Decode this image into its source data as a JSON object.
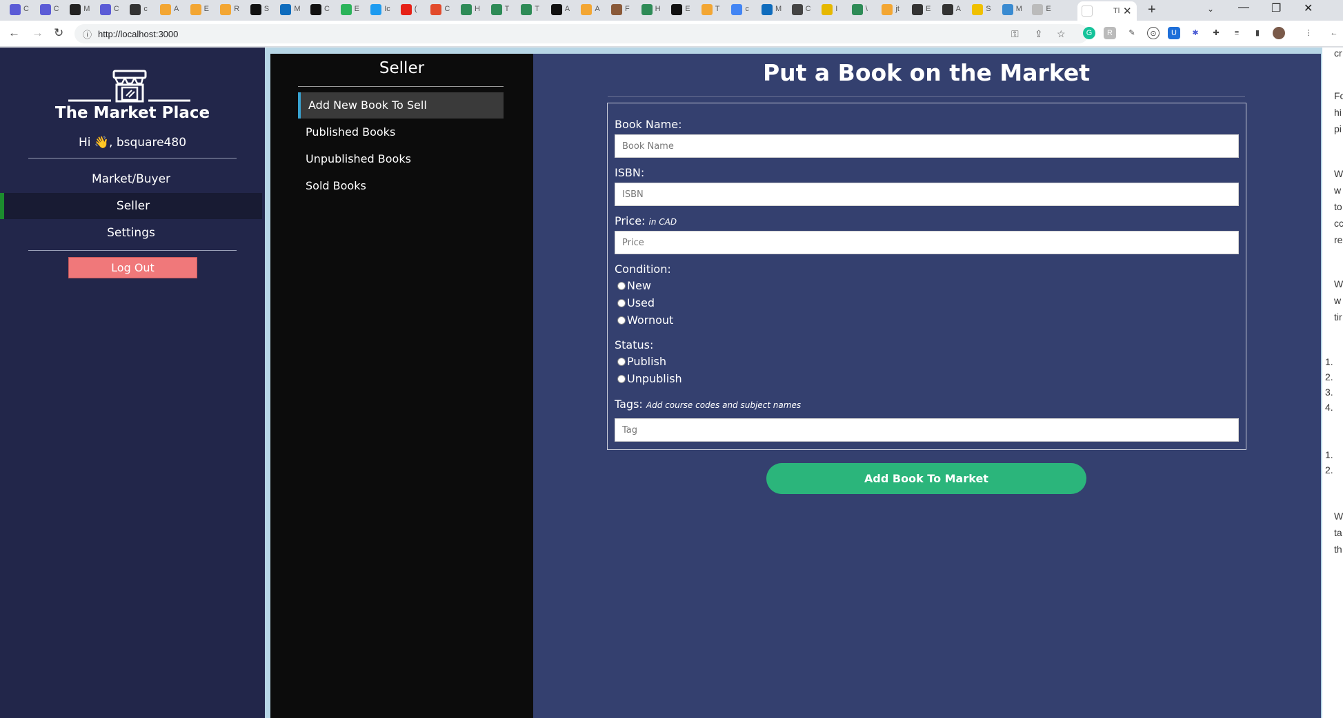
{
  "browser": {
    "active_tab_label": "Tl",
    "url": "http://localhost:3000",
    "tab_labels": [
      "C",
      "C",
      "M",
      "C",
      "c",
      "A",
      "E",
      "R",
      "S",
      "M",
      "C",
      "E",
      "Ic",
      "(",
      "C",
      "H",
      "T",
      "T",
      "A",
      "A",
      "F",
      "H",
      "E",
      "T",
      "c",
      "M",
      "C",
      "I",
      "\\",
      "jt",
      "E",
      "A",
      "S",
      "M",
      "E"
    ]
  },
  "sidebar": {
    "brand": "The Market Place",
    "greeting": "Hi 👋, bsquare480",
    "nav": [
      {
        "label": "Market/Buyer",
        "active": false
      },
      {
        "label": "Seller",
        "active": true
      },
      {
        "label": "Settings",
        "active": false
      }
    ],
    "logout_label": "Log Out"
  },
  "seller_panel": {
    "title": "Seller",
    "items": [
      {
        "label": "Add New Book To Sell",
        "active": true
      },
      {
        "label": "Published Books",
        "active": false
      },
      {
        "label": "Unpublished Books",
        "active": false
      },
      {
        "label": "Sold Books",
        "active": false
      }
    ]
  },
  "form": {
    "title": "Put a Book on the Market",
    "book_name": {
      "label": "Book Name:",
      "placeholder": "Book Name",
      "value": ""
    },
    "isbn": {
      "label": "ISBN:",
      "placeholder": "ISBN",
      "value": ""
    },
    "price": {
      "label": "Price:",
      "hint": "in CAD",
      "placeholder": "Price",
      "value": ""
    },
    "condition": {
      "label": "Condition:",
      "options": [
        "New",
        "Used",
        "Wornout"
      ]
    },
    "status": {
      "label": "Status:",
      "options": [
        "Publish",
        "Unpublish"
      ]
    },
    "tags": {
      "label": "Tags:",
      "hint": "Add course codes and subject names",
      "placeholder": "Tag",
      "value": ""
    },
    "submit_label": "Add Book To Market"
  },
  "right_strip": {
    "lines": [
      "cr",
      "Fo",
      "hi",
      "pi",
      "W",
      "w",
      "to",
      "cc",
      "re",
      "W",
      "w",
      "tir",
      "1.",
      "2.",
      "3.",
      "4.",
      "1.",
      "2.",
      "W",
      "ta",
      "th"
    ]
  },
  "colors": {
    "sidebar_bg": "#22264a",
    "seller_bg": "#0c0c0c",
    "main_bg": "#34406f",
    "accent_green": "#2bb57b",
    "logout_red": "#f0787a"
  }
}
